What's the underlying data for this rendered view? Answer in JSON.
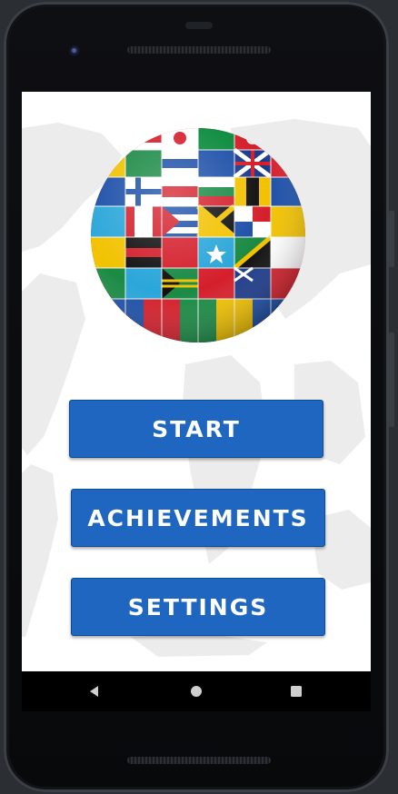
{
  "buttons": {
    "start": "START",
    "achievements": "ACHIEVEMENTS",
    "settings": "SETTINGS"
  },
  "navigation": {
    "back_icon": "back-triangle-icon",
    "home_icon": "home-circle-icon",
    "recents_icon": "recents-square-icon"
  },
  "images": {
    "logo": "flag-globe-logo",
    "background": "world-map"
  },
  "colors": {
    "button_bg": "#1e66c0",
    "button_text": "#ffffff",
    "screen_bg": "#ffffff",
    "map_tint": "#eeeeee"
  }
}
